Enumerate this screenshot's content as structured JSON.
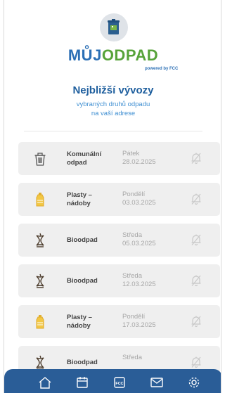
{
  "brand": {
    "moj": "MŮJ",
    "odpad": "ODPAD",
    "powered": "powered by FCC"
  },
  "header": {
    "title": "Nejbližší vývozy",
    "subtitle_line1": "vybraných druhů odpadu",
    "subtitle_line2": "na vaší adrese"
  },
  "pickups": [
    {
      "icon": "trash-bin-icon",
      "type_line1": "Komunální",
      "type_line2": "odpad",
      "day": "Pátek",
      "date": "28.02.2025"
    },
    {
      "icon": "plastic-bottle-icon",
      "type_line1": "Plasty –",
      "type_line2": "nádoby",
      "day": "Pondělí",
      "date": "03.03.2025"
    },
    {
      "icon": "apple-core-icon",
      "type_line1": "Bioodpad",
      "type_line2": "",
      "day": "Středa",
      "date": "05.03.2025"
    },
    {
      "icon": "apple-core-icon",
      "type_line1": "Bioodpad",
      "type_line2": "",
      "day": "Středa",
      "date": "12.03.2025"
    },
    {
      "icon": "plastic-bottle-icon",
      "type_line1": "Plasty –",
      "type_line2": "nádoby",
      "day": "Pondělí",
      "date": "17.03.2025"
    },
    {
      "icon": "apple-core-icon",
      "type_line1": "Bioodpad",
      "type_line2": "",
      "day": "Středa",
      "date": ""
    }
  ],
  "navbar": {
    "items": [
      "home-icon",
      "calendar-icon",
      "fcc-icon",
      "mail-icon",
      "settings-icon"
    ],
    "fcc_label": "FCC"
  },
  "colors": {
    "brand_blue": "#2b6fb5",
    "brand_green": "#57a33a",
    "navbar": "#2a5d97",
    "row_bg": "#efefef",
    "bottle_yellow": "#f2c744"
  }
}
